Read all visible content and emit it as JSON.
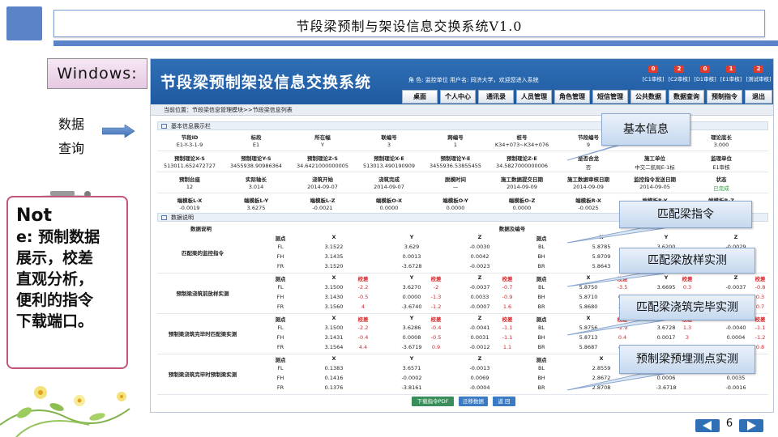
{
  "slide": {
    "title": "节段梁预制与架设信息交换系统V1.0",
    "windows_label": "Windows:",
    "side_label_1": "数据",
    "side_label_2": "查询",
    "note_title": "Not",
    "note_lines": [
      "e: 预制数据",
      "展示，校差",
      "直观分析，",
      "便利的指令",
      "下载端口。"
    ],
    "page_number": "6"
  },
  "app": {
    "title": "节段梁预制架设信息交换系统",
    "user_info": "角 色: 监控单位   用户名: 同济大学，欢迎您进入系统",
    "badges": [
      {
        "count": "0",
        "label": "[C1审核]"
      },
      {
        "count": "2",
        "label": "[C2审核]"
      },
      {
        "count": "0",
        "label": "[D1审核]"
      },
      {
        "count": "1",
        "label": "[E1审核]"
      },
      {
        "count": "2",
        "label": "[测试审核]"
      }
    ],
    "nav": [
      "桌面",
      "个人中心",
      "通讯录",
      "人员管理",
      "角色管理",
      "短信管理",
      "公共数据",
      "数据查询",
      "预制指令",
      "退出"
    ],
    "breadcrumb": "当前位置：节段梁信息管理模块>>节段梁信息列表",
    "basic_section": "基本信息展示栏",
    "data_section": "数据说明",
    "basic_rows": [
      {
        "labels": [
          "节段ID",
          "标段",
          "所在幅",
          "联编号",
          "跨编号",
          "桩号",
          "节段编号",
          "",
          "理论底长"
        ],
        "values": [
          "E1-Y-3-1-9",
          "E1",
          "Y",
          "3",
          "1",
          "K34+073~K34+076",
          "9",
          "",
          "3.000"
        ]
      },
      {
        "labels": [
          "预制理论X-S",
          "预制理论Y-S",
          "预制理论Z-S",
          "预制理论X-E",
          "预制理论Y-E",
          "预制理论Z-E",
          "是否合龙",
          "施工单位",
          "监理单位"
        ],
        "values": [
          "513011.652472727",
          "3455938.90986364",
          "34.6421000000005",
          "513013.490190909",
          "3455936.53855455",
          "34.5827000000006",
          "否",
          "中交二航局E-1标",
          "E1审核"
        ]
      },
      {
        "labels": [
          "预制台座",
          "实际轴长",
          "浇筑开始",
          "浇筑完成",
          "脱模时间",
          "施工数据提交日期",
          "施工数据审核日期",
          "监控指令发送日期",
          "状态"
        ],
        "values": [
          "12",
          "3.014",
          "2014-09-07",
          "2014-09-07",
          "—",
          "2014-09-09",
          "2014-09-09",
          "2014-09-05",
          "已完成"
        ]
      },
      {
        "labels": [
          "端模板L-X",
          "端模板L-Y",
          "端模板L-Z",
          "端模板O-X",
          "端模板O-Y",
          "端模板O-Z",
          "端模板R-X",
          "端模板R-Y",
          "端模板R-Z"
        ],
        "values": [
          "-0.0019",
          "3.6275",
          "-0.0021",
          "0.0000",
          "0.0000",
          "0.0000",
          "-0.0025",
          "",
          "-0.0021"
        ]
      }
    ],
    "data_header": {
      "desc": "数据说明",
      "group": "数据及编号"
    },
    "groups": [
      {
        "name": "匹配梁的监控指令",
        "header": [
          "测点",
          "X",
          "Y",
          "Z",
          "测点",
          "X",
          "Y",
          "Z"
        ],
        "rows": [
          [
            "FL",
            "3.1522",
            "3.629",
            "-0.0030",
            "BL",
            "5.8785",
            "3.6200",
            "-0.0029"
          ],
          [
            "FH",
            "3.1435",
            "0.0013",
            "0.0042",
            "BH",
            "5.8709",
            "0.0011",
            "0.0016"
          ],
          [
            "FR",
            "3.1520",
            "-3.6728",
            "-0.0023",
            "BR",
            "5.8643",
            "-3.6700",
            "-0.0016"
          ]
        ],
        "has_check": false
      },
      {
        "name": "预制梁浇筑前放样实测",
        "header": [
          "测点",
          "X",
          "校差",
          "Y",
          "校差",
          "Z",
          "校差",
          "测点",
          "X",
          "校差",
          "Y",
          "校差",
          "Z",
          "校差"
        ],
        "rows": [
          [
            "FL",
            "3.1500",
            "-2.2",
            "3.6270",
            "-2",
            "-0.0037",
            "-0.7",
            "BL",
            "5.8750",
            "-3.5",
            "3.6695",
            "0.3",
            "-0.0037",
            "-0.8"
          ],
          [
            "FH",
            "3.1430",
            "-0.5",
            "0.0000",
            "-1.3",
            "0.0033",
            "-0.9",
            "BH",
            "5.8710",
            "0.1",
            "0.0015",
            "0.4",
            "0.0013",
            "0.3"
          ],
          [
            "FR",
            "3.1560",
            "4",
            "-3.6740",
            "-1.2",
            "-0.0007",
            "1.6",
            "BR",
            "5.8680",
            "3.7",
            "-3.6695",
            "0.5",
            "0.0021",
            "0.7"
          ]
        ],
        "has_check": true
      },
      {
        "name": "预制梁浇筑完毕时匹配梁实测",
        "header": [
          "测点",
          "X",
          "校差",
          "Y",
          "校差",
          "Z",
          "校差",
          "测点",
          "X",
          "校差",
          "Y",
          "校差",
          "Z",
          "校差"
        ],
        "rows": [
          [
            "FL",
            "3.1500",
            "-2.2",
            "3.6286",
            "-0.4",
            "-0.0041",
            "-1.1",
            "BL",
            "5.8756",
            "-2.9",
            "3.6728",
            "1.3",
            "-0.0040",
            "-1.1"
          ],
          [
            "FH",
            "3.1431",
            "-0.4",
            "0.0008",
            "-0.5",
            "0.0031",
            "-1.1",
            "BH",
            "5.8713",
            "0.4",
            "0.0017",
            "3",
            "0.0004",
            "-1.2"
          ],
          [
            "FR",
            "3.1564",
            "4.4",
            "-3.6719",
            "0.9",
            "-0.0012",
            "1.1",
            "BR",
            "5.8687",
            "4.4",
            "-3.6805",
            "1.9",
            "-0.0016",
            "0.8"
          ]
        ],
        "has_check": true
      },
      {
        "name": "预制梁浇筑完毕时预制梁实测",
        "header": [
          "测点",
          "X",
          "Y",
          "Z",
          "测点",
          "X",
          "Y",
          "Z"
        ],
        "rows": [
          [
            "FL",
            "0.1383",
            "3.6571",
            "-0.0013",
            "BL",
            "2.8559",
            "3.6652",
            "-0.0032"
          ],
          [
            "FH",
            "0.1416",
            "-0.0002",
            "0.0069",
            "BH",
            "2.8672",
            "0.0006",
            "0.0035"
          ],
          [
            "FR",
            "0.1376",
            "-3.8161",
            "-0.0004",
            "BR",
            "2.8708",
            "-3.6718",
            "-0.0016"
          ]
        ],
        "has_check": false
      }
    ],
    "buttons": [
      "下载指令PDF",
      "迁移数据",
      "返 回"
    ]
  },
  "callouts": [
    "基本信息",
    "匹配梁指令",
    "匹配梁放样实测",
    "匹配梁浇筑完毕实测",
    "预制梁预埋测点实测"
  ],
  "colors": {
    "accent": "#5b83c7",
    "app_header": "#1f5aa0",
    "check_red": "#d8262b",
    "note_border": "#c4557a"
  }
}
